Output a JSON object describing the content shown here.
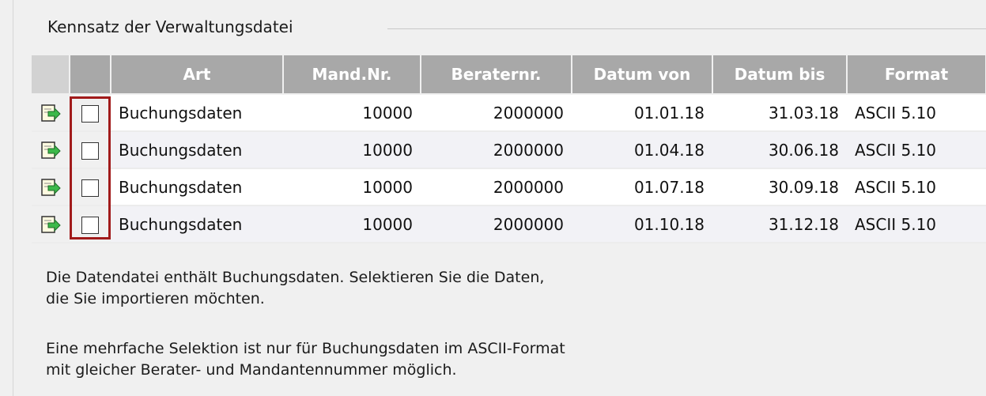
{
  "group": {
    "title": "Kennsatz der Verwaltungsdatei"
  },
  "table": {
    "columns": [
      "Art",
      "Mand.Nr.",
      "Beraternr.",
      "Datum von",
      "Datum bis",
      "Format"
    ],
    "rows": [
      {
        "art": "Buchungsdaten",
        "mand": "10000",
        "berater": "2000000",
        "von": "01.01.18",
        "bis": "31.03.18",
        "format": "ASCII 5.10",
        "checked": false
      },
      {
        "art": "Buchungsdaten",
        "mand": "10000",
        "berater": "2000000",
        "von": "01.04.18",
        "bis": "30.06.18",
        "format": "ASCII 5.10",
        "checked": false
      },
      {
        "art": "Buchungsdaten",
        "mand": "10000",
        "berater": "2000000",
        "von": "01.07.18",
        "bis": "30.09.18",
        "format": "ASCII 5.10",
        "checked": false
      },
      {
        "art": "Buchungsdaten",
        "mand": "10000",
        "berater": "2000000",
        "von": "01.10.18",
        "bis": "31.12.18",
        "format": "ASCII 5.10",
        "checked": false
      }
    ]
  },
  "info": {
    "line1": "Die Datendatei enthält Buchungsdaten. Selektieren Sie die Daten,",
    "line2": "die Sie importieren möchten.",
    "line3": "Eine mehrfache Selektion ist nur für Buchungsdaten im ASCII-Format",
    "line4": "mit gleicher Berater- und Mandantennummer möglich."
  },
  "icons": {
    "row_icon": "import-document-icon"
  },
  "colors": {
    "header_bg": "#a8a8a8",
    "highlight_border": "#a11b1b",
    "icon_green": "#3cb94a"
  }
}
